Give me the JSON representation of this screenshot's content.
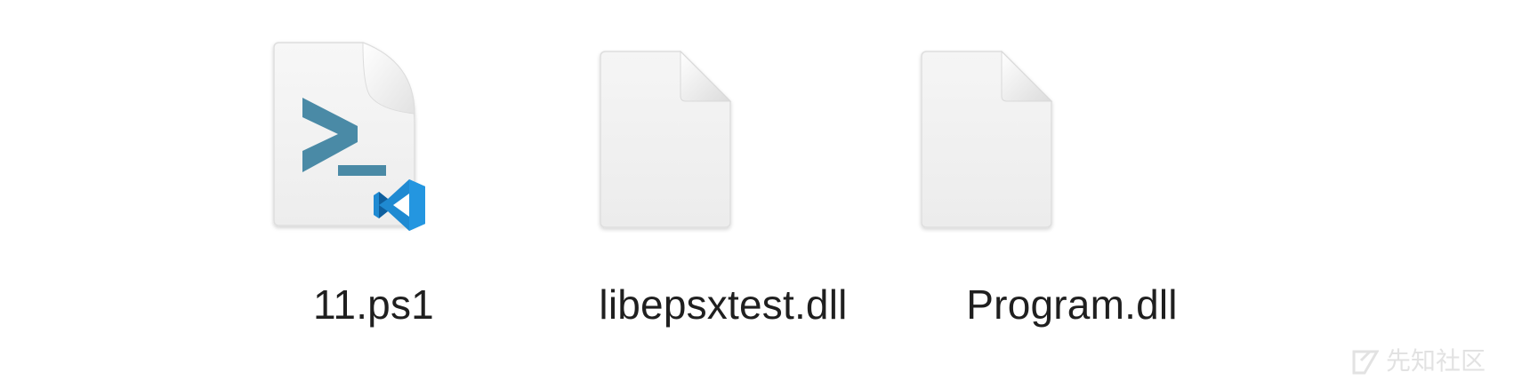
{
  "files": [
    {
      "name": "11.ps1",
      "icon": "powershell-script-icon",
      "badge": "vscode-badge-icon"
    },
    {
      "name": "libepsxtest.dll",
      "icon": "generic-document-icon"
    },
    {
      "name": "Program.dll",
      "icon": "generic-document-icon"
    }
  ],
  "colors": {
    "prompt": "#4a8aa6",
    "vscode_blue": "#1f8ad2",
    "vscode_dark": "#0f5f9e",
    "page_fill": "#f3f3f3",
    "page_edge": "#dddddd",
    "label": "#1f1f1f"
  },
  "watermark": {
    "text": "先知社区",
    "icon": "xianzhi-logo-icon"
  }
}
